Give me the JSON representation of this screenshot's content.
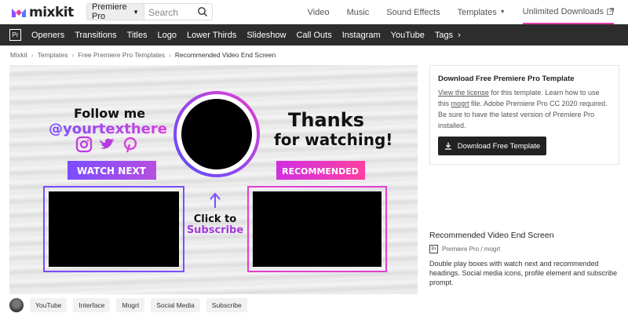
{
  "brand": {
    "name": "mixkit",
    "accent": "#e33fa2"
  },
  "search": {
    "product_selected": "Premiere Pro",
    "placeholder": "Search"
  },
  "topnav": [
    {
      "label": "Video"
    },
    {
      "label": "Music"
    },
    {
      "label": "Sound Effects"
    },
    {
      "label": "Templates"
    },
    {
      "label": "Unlimited Downloads"
    }
  ],
  "categories": {
    "badge": "Pr",
    "items": [
      "Openers",
      "Transitions",
      "Titles",
      "Logo",
      "Lower Thirds",
      "Slideshow",
      "Call Outs",
      "Instagram",
      "YouTube",
      "Tags"
    ]
  },
  "breadcrumb": [
    "Mixkit",
    "Templates",
    "Free Premiere Pro Templates",
    "Recommended Video End Screen"
  ],
  "preview": {
    "follow": "Follow me",
    "handle": "@yourtexthere",
    "watch_next": "WATCH NEXT",
    "thanks": "Thanks",
    "for_watching": "for watching!",
    "recommended": "RECOMMENDED",
    "click_to": "Click to",
    "subscribe": "Subscribe"
  },
  "info": {
    "title": "Download Free Premiere Pro Template",
    "license_link": "View the license",
    "text1": " for this template. Learn how to use this ",
    "mogrt_link": "mogrt",
    "text2": " file. Adobe Premiere Pro CC 2020 required. Be sure to have the latest version of Premiere Pro installed.",
    "download_label": "Download Free Template"
  },
  "item": {
    "title": "Recommended Video End Screen",
    "meta_badge": "Pr",
    "meta": "Premiere Pro / mogrt",
    "description": "Double play boxes with watch next and recommended headings. Social media icons, profile element and subscribe prompt."
  },
  "tags": [
    "YouTube",
    "Interface",
    "Mogrt",
    "Social Media",
    "Subscribe"
  ]
}
